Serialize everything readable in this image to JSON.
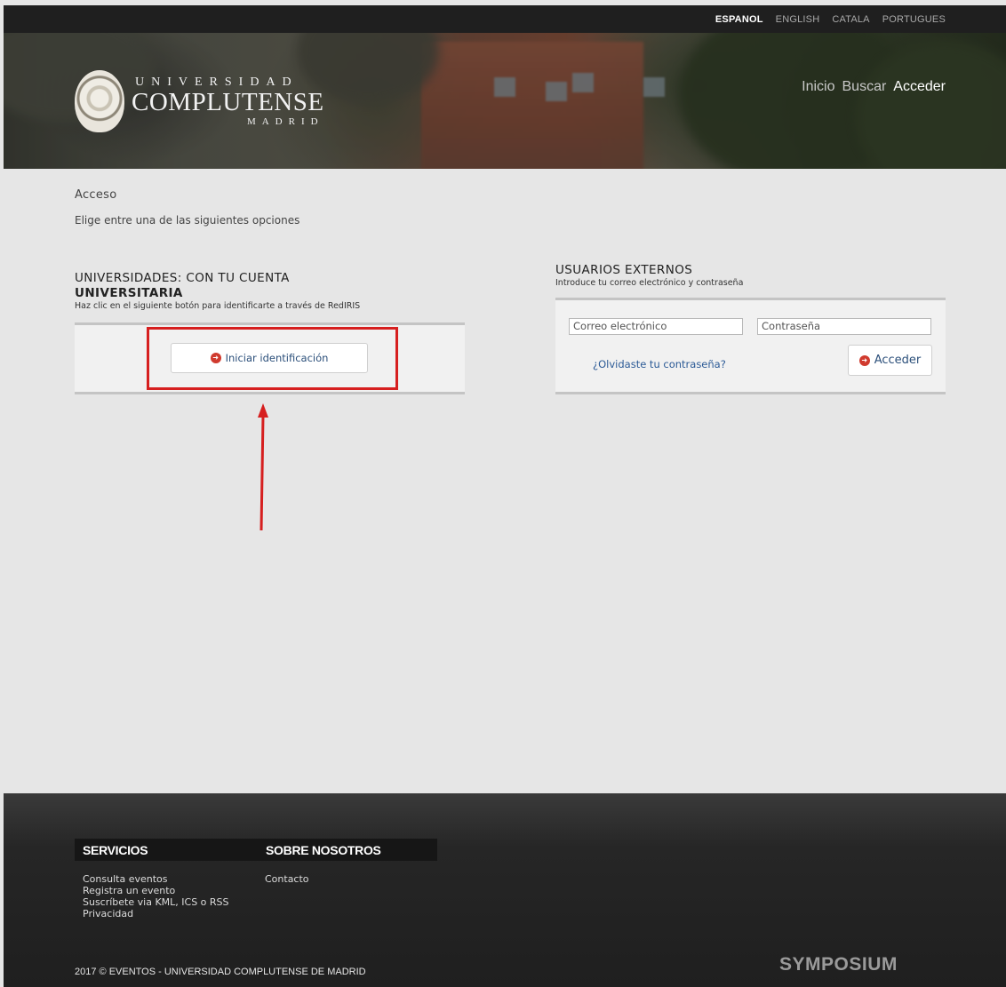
{
  "languages": [
    {
      "label": "ESPANOL",
      "active": true
    },
    {
      "label": "ENGLISH",
      "active": false
    },
    {
      "label": "CATALA",
      "active": false
    },
    {
      "label": "PORTUGUES",
      "active": false
    }
  ],
  "logo": {
    "line1": "UNIVERSIDAD",
    "line2": "COMPLUTENSE",
    "line3": "MADRID"
  },
  "nav": {
    "inicio": "Inicio",
    "buscar": "Buscar",
    "acceder": "Acceder"
  },
  "page": {
    "title": "Acceso",
    "subtitle": "Elige entre una de las siguientes opciones"
  },
  "universities": {
    "title_line1": "UNIVERSIDADES: CON TU CUENTA",
    "title_line2": "UNIVERSITARIA",
    "description": "Haz clic en el siguiente botón para identificarte a través de RedIRIS",
    "button_label": "Iniciar identificación"
  },
  "external": {
    "title": "USUARIOS EXTERNOS",
    "description": "Introduce tu correo electrónico y contraseña",
    "email_placeholder": "Correo electrónico",
    "password_placeholder": "Contraseña",
    "forgot_label": "¿Olvidaste tu contraseña?",
    "submit_label": "Acceder"
  },
  "footer": {
    "services_heading": "SERVICIOS",
    "services": [
      "Consulta eventos",
      "Registra un evento",
      "Suscríbete via KML, ICS o RSS",
      "Privacidad"
    ],
    "about_heading": "SOBRE NOSOTROS",
    "about": [
      "Contacto"
    ],
    "copyright": "2017 © EVENTOS - UNIVERSIDAD COMPLUTENSE DE MADRID",
    "brand": "SYMPOSIUM"
  },
  "colors": {
    "highlight": "#d61f1f",
    "accent_icon": "#d03a2e",
    "link": "#2b5a96"
  }
}
